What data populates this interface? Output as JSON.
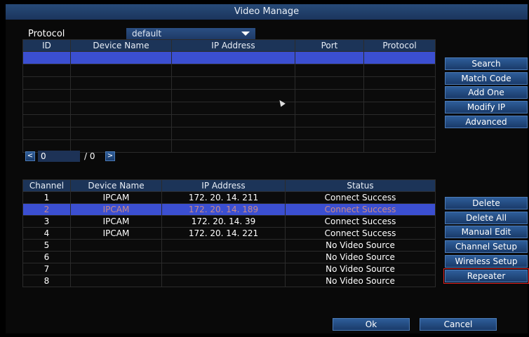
{
  "window": {
    "title": "Video Manage"
  },
  "protocol": {
    "label": "Protocol",
    "value": "default"
  },
  "search_table": {
    "headers": [
      "ID",
      "Device Name",
      "IP Address",
      "Port",
      "Protocol"
    ],
    "rows": [
      [
        "",
        "",
        "",
        "",
        ""
      ],
      [
        "",
        "",
        "",
        "",
        ""
      ],
      [
        "",
        "",
        "",
        "",
        ""
      ],
      [
        "",
        "",
        "",
        "",
        ""
      ],
      [
        "",
        "",
        "",
        "",
        ""
      ],
      [
        "",
        "",
        "",
        "",
        ""
      ],
      [
        "",
        "",
        "",
        "",
        ""
      ],
      [
        "",
        "",
        "",
        "",
        ""
      ]
    ],
    "selected_row": 0
  },
  "side_buttons_top": [
    "Search",
    "Match Code",
    "Add One",
    "Modify IP",
    "Advanced"
  ],
  "pager": {
    "prev": "<",
    "current": "0",
    "separator": "/",
    "total": "0",
    "next": ">"
  },
  "channel_table": {
    "headers": [
      "Channel",
      "Device Name",
      "IP Address",
      "Status"
    ],
    "rows": [
      [
        "1",
        "IPCAM",
        "172. 20. 14. 211",
        "Connect Success"
      ],
      [
        "2",
        "IPCAM",
        "172. 20. 14. 189",
        "Connect Success"
      ],
      [
        "3",
        "IPCAM",
        "172. 20. 14. 39",
        "Connect Success"
      ],
      [
        "4",
        "IPCAM",
        "172. 20. 14. 221",
        "Connect Success"
      ],
      [
        "5",
        "",
        "",
        "No Video Source"
      ],
      [
        "6",
        "",
        "",
        "No Video Source"
      ],
      [
        "7",
        "",
        "",
        "No Video Source"
      ],
      [
        "8",
        "",
        "",
        "No Video Source"
      ]
    ],
    "selected_row": 1
  },
  "side_buttons_bottom": [
    "Delete",
    "Delete All",
    "Manual Edit",
    "Channel Setup",
    "Wireless Setup",
    "Repeater"
  ],
  "footer": {
    "ok": "Ok",
    "cancel": "Cancel"
  },
  "colors": {
    "title_bar": "#274a78",
    "selected_row": "#3b4fd1",
    "highlight_outline": "#e02020"
  }
}
